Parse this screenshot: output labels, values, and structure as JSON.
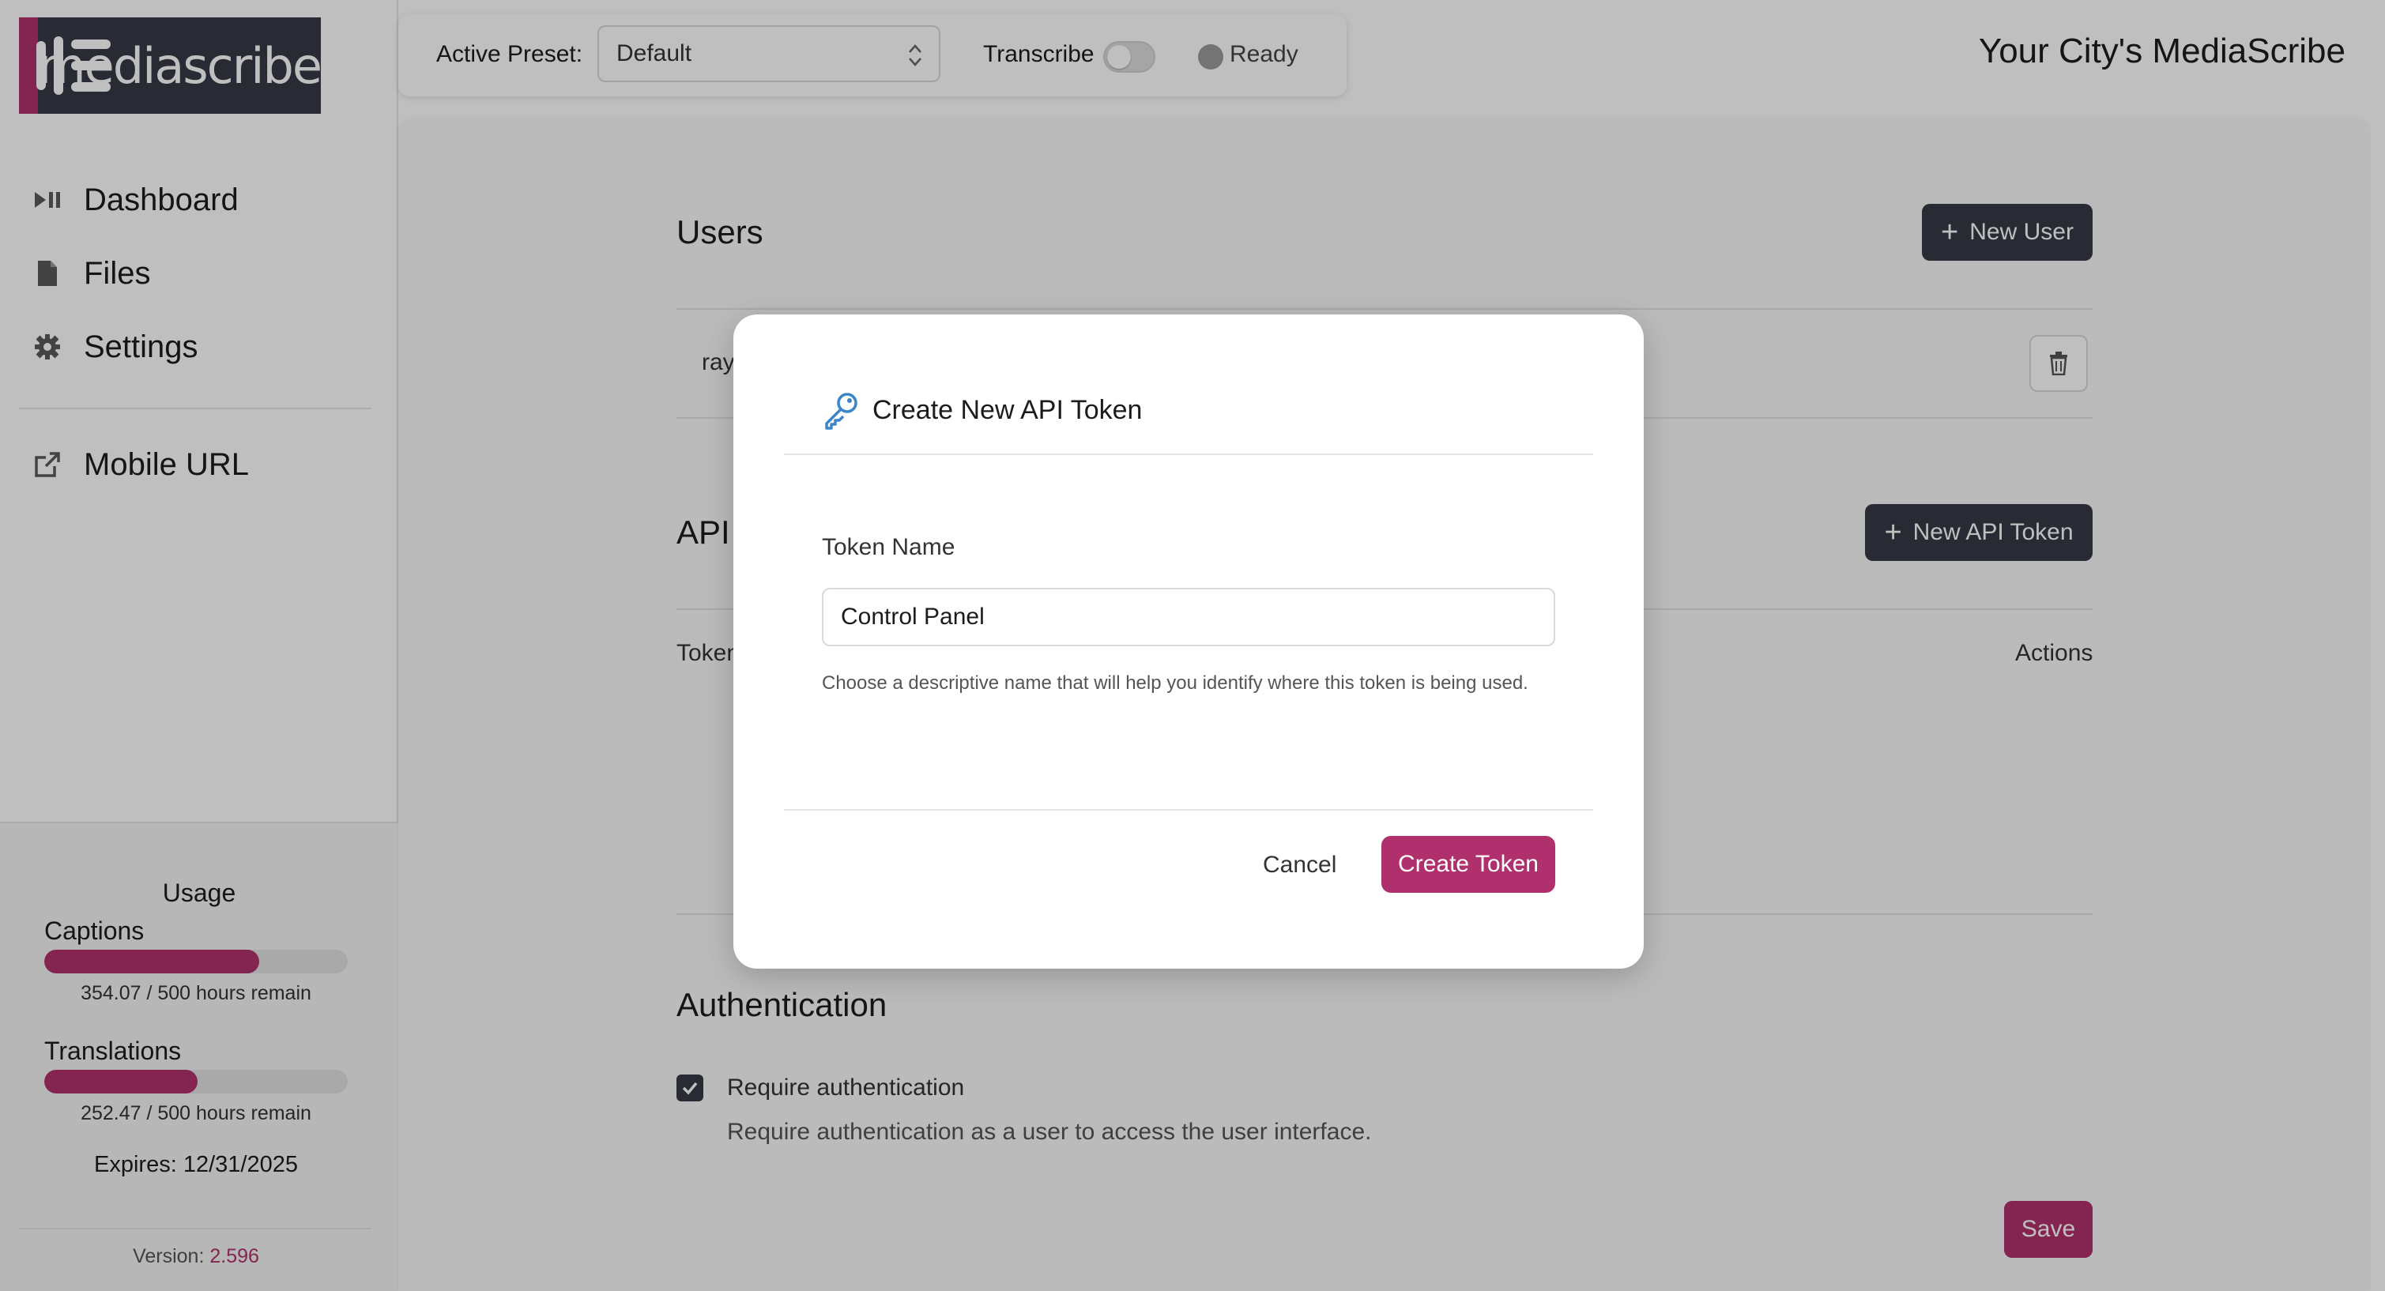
{
  "brand": {
    "logo_text": "mediascribe",
    "accent": "#b0306d",
    "dark": "#363a46"
  },
  "site_title": "Your City's MediaScribe",
  "nav": {
    "items": [
      {
        "label": "Dashboard",
        "icon": "play-pause-icon"
      },
      {
        "label": "Files",
        "icon": "file-icon"
      },
      {
        "label": "Settings",
        "icon": "gear-icon"
      },
      {
        "label": "Mobile URL",
        "icon": "external-link-icon"
      }
    ]
  },
  "usage": {
    "title": "Usage",
    "captions": {
      "label": "Captions",
      "remaining_text": "354.07 / 500 hours remain",
      "fraction": 0.708
    },
    "translations": {
      "label": "Translations",
      "remaining_text": "252.47 / 500 hours remain",
      "fraction": 0.505
    },
    "expires": "Expires: 12/31/2025",
    "version_label": "Version:",
    "version": "2.596"
  },
  "toolbar": {
    "preset_label": "Active Preset:",
    "preset_value": "Default",
    "transcribe_label": "Transcribe",
    "status": "Ready"
  },
  "users": {
    "title": "Users",
    "new_button": "New User",
    "row_name": "ray"
  },
  "api_tokens": {
    "title": "API",
    "new_button": "New API Token",
    "col_token": "Token",
    "col_actions": "Actions"
  },
  "auth": {
    "title": "Authentication",
    "checkbox_label": "Require authentication",
    "help": "Require authentication as a user to access the user interface.",
    "save": "Save"
  },
  "modal": {
    "title": "Create New API Token",
    "field_label": "Token Name",
    "field_value": "Control Panel",
    "help": "Choose a descriptive name that will help you identify where this token is being used.",
    "cancel": "Cancel",
    "create": "Create Token"
  }
}
